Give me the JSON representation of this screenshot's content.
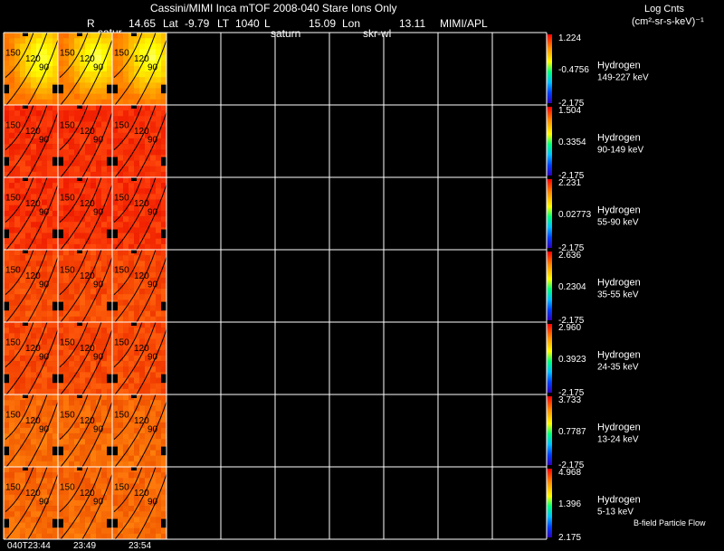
{
  "header": {
    "title": "Cassini/MIMI Inca mTOF  2008-040   Stare    Ions Only",
    "r_label": "R",
    "r_value": "14.65",
    "lat_label": "Lat",
    "lat_value": "-9.79",
    "lt_label": "LT",
    "lt_value": "1040",
    "l_label": "L",
    "lon_value": "15.09",
    "lon_label": "Lon",
    "lon2_value": "13.11",
    "credit": "MIMI/APL",
    "overlay_1": "satur",
    "overlay_2": "saturn",
    "overlay_3": "skr-wl"
  },
  "units": {
    "line1": "Log Cnts",
    "line2": "(cm²-sr-s-keV)⁻¹"
  },
  "footer": {
    "time_1": "040T23:44",
    "time_2": "23:49",
    "time_3": "23:54",
    "note": "B-field Particle Flow"
  },
  "chart_data": {
    "type": "heatmap",
    "columns": 10,
    "filled_columns": 3,
    "contour_labels": [
      "150",
      "120",
      "90"
    ],
    "time_labels": [
      "040T23:44",
      "23:49",
      "23:54"
    ],
    "rows": [
      {
        "species": "Hydrogen",
        "energy": "149-227 keV",
        "max": "1.224",
        "mid": "-0.4756",
        "min": "-2.175",
        "theme": "hot"
      },
      {
        "species": "Hydrogen",
        "energy": "90-149 keV",
        "max": "1.504",
        "mid": "0.3354",
        "min": "-2.175",
        "theme": "red"
      },
      {
        "species": "Hydrogen",
        "energy": "55-90 keV",
        "max": "2.231",
        "mid": "0.02773",
        "min": "-2.175",
        "theme": "red"
      },
      {
        "species": "Hydrogen",
        "energy": "35-55 keV",
        "max": "2.636",
        "mid": "0.2304",
        "min": "-2.175",
        "theme": "redorange"
      },
      {
        "species": "Hydrogen",
        "energy": "24-35 keV",
        "max": "2.960",
        "mid": "0.3923",
        "min": "-2.175",
        "theme": "redorange"
      },
      {
        "species": "Hydrogen",
        "energy": "13-24 keV",
        "max": "3.733",
        "mid": "0.7787",
        "min": "-2.175",
        "theme": "orange"
      },
      {
        "species": "Hydrogen",
        "energy": "5-13 keV",
        "max": "4.968",
        "mid": "1.396",
        "min": "2.175",
        "theme": "orange"
      }
    ]
  }
}
